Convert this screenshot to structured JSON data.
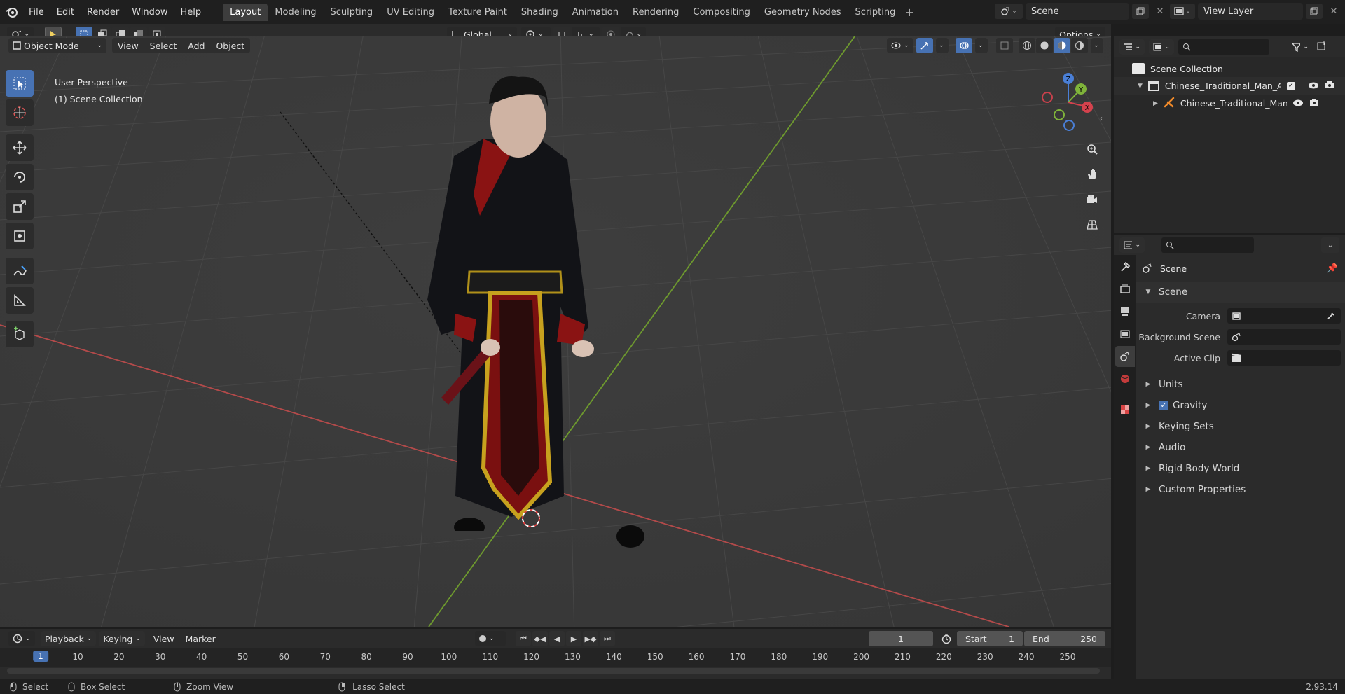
{
  "menu": {
    "items": [
      "File",
      "Edit",
      "Render",
      "Window",
      "Help"
    ]
  },
  "workspaces": {
    "tabs": [
      "Layout",
      "Modeling",
      "Sculpting",
      "UV Editing",
      "Texture Paint",
      "Shading",
      "Animation",
      "Rendering",
      "Compositing",
      "Geometry Nodes",
      "Scripting"
    ],
    "active": "Layout"
  },
  "scene_selector": {
    "value": "Scene"
  },
  "view_layer": {
    "value": "View Layer"
  },
  "viewport_header": {
    "mode": "Object Mode",
    "menus": [
      "View",
      "Select",
      "Add",
      "Object"
    ],
    "transform_orientation": "Global",
    "options": "Options"
  },
  "viewport": {
    "perspective": "User Perspective",
    "collection": "(1) Scene Collection",
    "gizmo": {
      "z": "Z",
      "y": "Y",
      "x": "X"
    }
  },
  "outliner": {
    "root": "Scene Collection",
    "items": [
      {
        "label": "Chinese_Traditional_Man_Agg"
      },
      {
        "label": "Chinese_Traditional_Man"
      }
    ]
  },
  "properties": {
    "context_label": "Scene",
    "section_title": "Scene",
    "fields": [
      {
        "label": "Camera"
      },
      {
        "label": "Background Scene"
      },
      {
        "label": "Active Clip"
      }
    ],
    "panels": [
      "Units",
      "Gravity",
      "Keying Sets",
      "Audio",
      "Rigid Body World",
      "Custom Properties"
    ]
  },
  "timeline": {
    "menus": [
      "Playback",
      "Keying",
      "View",
      "Marker"
    ],
    "current_frame": "1",
    "start_label": "Start",
    "start_value": "1",
    "end_label": "End",
    "end_value": "250",
    "ruler_ticks": [
      "1",
      "10",
      "20",
      "30",
      "40",
      "50",
      "60",
      "70",
      "80",
      "90",
      "100",
      "110",
      "120",
      "130",
      "140",
      "150",
      "160",
      "170",
      "180",
      "190",
      "200",
      "210",
      "220",
      "230",
      "240",
      "250"
    ]
  },
  "statusbar": {
    "select": "Select",
    "box_select": "Box Select",
    "zoom_view": "Zoom View",
    "lasso_select": "Lasso Select",
    "version": "2.93.14"
  }
}
